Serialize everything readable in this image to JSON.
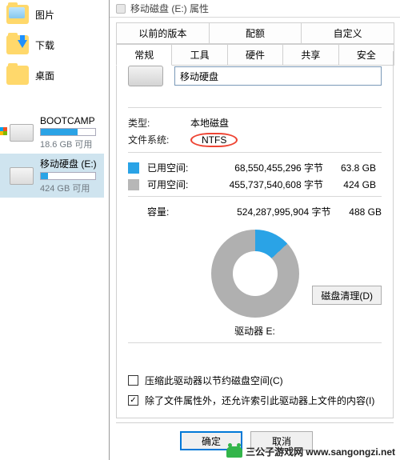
{
  "sidebar": {
    "folders": [
      {
        "label": "图片"
      },
      {
        "label": "下载"
      },
      {
        "label": "桌面"
      }
    ],
    "drives": [
      {
        "name": "BOOTCAMP",
        "sub": "18.6 GB 可用",
        "used_pct": 67
      },
      {
        "name": "移动硬盘 (E:)",
        "sub": "424 GB 可用",
        "used_pct": 13
      }
    ]
  },
  "dialog": {
    "title": "移动磁盘 (E:) 属性",
    "tabrow_top": [
      "以前的版本",
      "配额",
      "自定义"
    ],
    "tabrow_bot": [
      "常规",
      "工具",
      "硬件",
      "共享",
      "安全"
    ],
    "active_tab": "常规",
    "drive_name": "移动硬盘",
    "type_label": "类型:",
    "type_value": "本地磁盘",
    "fs_label": "文件系统:",
    "fs_value": "NTFS",
    "used_label": "已用空间:",
    "used_bytes": "68,550,455,296 字节",
    "used_gb": "63.8 GB",
    "free_label": "可用空间:",
    "free_bytes": "455,737,540,608 字节",
    "free_gb": "424 GB",
    "cap_label": "容量:",
    "cap_bytes": "524,287,995,904 字节",
    "cap_gb": "488 GB",
    "drive_caption": "驱动器 E:",
    "cleanup": "磁盘清理(D)",
    "check1": "压缩此驱动器以节约磁盘空间(C)",
    "check2": "除了文件属性外，还允许索引此驱动器上文件的内容(I)",
    "ok": "确定",
    "cancel": "取消"
  },
  "watermark": "三公子游戏网  www.sangongzi.net",
  "chart_data": {
    "type": "pie",
    "title": "驱动器 E:",
    "series": [
      {
        "name": "已用空间",
        "value": 63.8,
        "unit": "GB",
        "bytes": 68550455296,
        "color": "#2aa3e6"
      },
      {
        "name": "可用空间",
        "value": 424,
        "unit": "GB",
        "bytes": 455737540608,
        "color": "#b0b0b0"
      }
    ],
    "total": {
      "label": "容量",
      "value": 488,
      "unit": "GB",
      "bytes": 524287995904
    }
  }
}
